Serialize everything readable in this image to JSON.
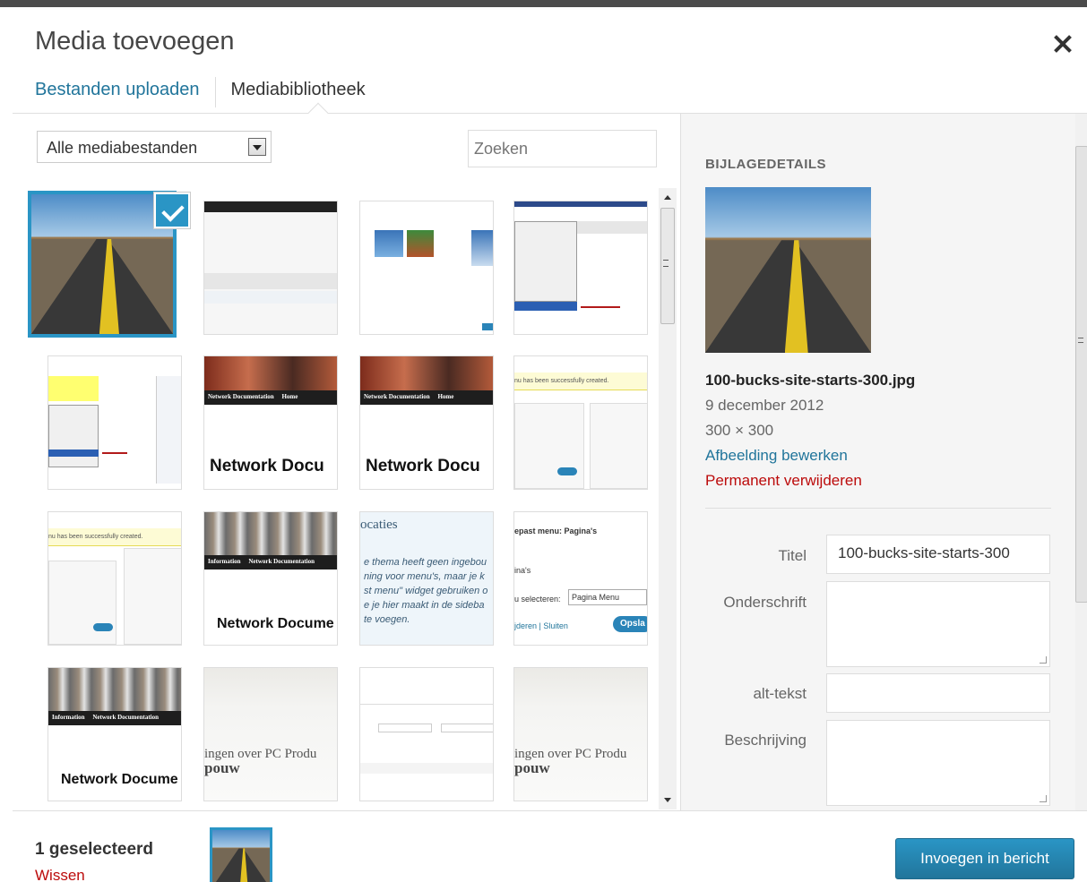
{
  "modal": {
    "title": "Media toevoegen",
    "tabs": [
      {
        "label": "Bestanden uploaden"
      },
      {
        "label": "Mediabibliotheek"
      }
    ]
  },
  "toolbar": {
    "filter_value": "Alle mediabestanden",
    "search_placeholder": "Zoeken"
  },
  "grid": {
    "thumb_texts": {
      "network_docu": "Network Docu",
      "network_docume": "Network Docume",
      "header_network_doc": "Network Documentation",
      "header_home": "Home",
      "header_information": "Information",
      "locaties": "ocaties",
      "locaties_body": [
        "e thema heeft geen ingebou",
        "ning voor menu's, maar je k",
        "st menu\" widget gebruiken o",
        "e je hier maakt in de sideba",
        "te voegen."
      ],
      "menu_title": "epast menu: Pagina's",
      "menu_sub": "ina's",
      "menu_select_label": "u selecteren:",
      "menu_select_value": "Pagina Menu",
      "menu_links": "jderen | Sluiten",
      "menu_btn": "Opsla",
      "menu_created": "nu has been successfully created.",
      "pc_text": "ingen over PC Produ",
      "pc_text2": "pouw"
    }
  },
  "details": {
    "heading": "BIJLAGEDETAILS",
    "filename": "100-bucks-site-starts-300.jpg",
    "date": "9 december 2012",
    "dimensions": "300 × 300",
    "edit_link": "Afbeelding bewerken",
    "delete_link": "Permanent verwijderen",
    "fields": {
      "title_label": "Titel",
      "title_value": "100-bucks-site-starts-300",
      "caption_label": "Onderschrift",
      "alt_label": "alt-tekst",
      "description_label": "Beschrijving"
    }
  },
  "footer": {
    "selected_count": "1 geselecteerd",
    "clear_label": "Wissen",
    "insert_label": "Invoegen in bericht"
  }
}
